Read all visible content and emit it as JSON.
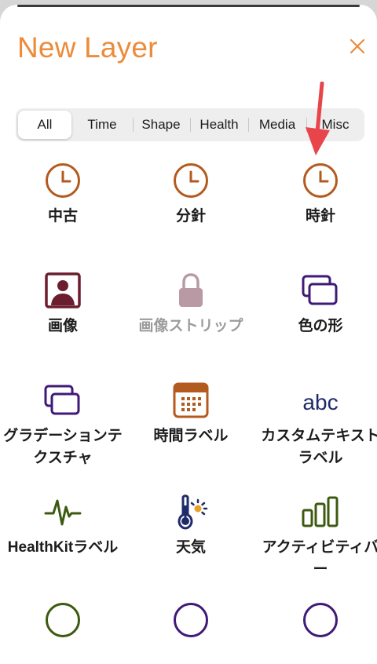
{
  "header": {
    "title": "New Layer",
    "close_icon": "close-icon",
    "accent": "#ec8b3a"
  },
  "tabs": [
    {
      "label": "All",
      "selected": true
    },
    {
      "label": "Time"
    },
    {
      "label": "Shape"
    },
    {
      "label": "Health"
    },
    {
      "label": "Media"
    },
    {
      "label": "Misc"
    }
  ],
  "layers": [
    {
      "label": "中古",
      "icon": "clock-icon",
      "color": "#b35a1f"
    },
    {
      "label": "分針",
      "icon": "clock-icon",
      "color": "#b35a1f"
    },
    {
      "label": "時針",
      "icon": "clock-icon",
      "color": "#b35a1f"
    },
    {
      "label": "画像",
      "icon": "portrait-icon",
      "color": "#6b1f2e"
    },
    {
      "label": "画像ストリップ",
      "icon": "lock-icon",
      "color": "#b99aa4",
      "disabled": true
    },
    {
      "label": "色の形",
      "icon": "cards-icon",
      "color": "#3f1a77"
    },
    {
      "label": "グラデーションテクスチャ",
      "icon": "cards-icon",
      "color": "#3f1a77"
    },
    {
      "label": "時間ラベル",
      "icon": "calendar-icon",
      "color": "#b35a1f"
    },
    {
      "label": "カスタムテキストラベル",
      "icon": "text-abc-icon",
      "text": "abc",
      "color": "#1f2a6b"
    },
    {
      "label": "HealthKitラベル",
      "icon": "heartbeat-icon",
      "color": "#3c5a10"
    },
    {
      "label": "天気",
      "icon": "weather-thermometer-icon",
      "color": "#1f2a6b"
    },
    {
      "label": "アクティビティバー",
      "icon": "activity-bars-icon",
      "color": "#3c5a10"
    },
    {
      "label": "",
      "icon": "circle-icon",
      "color": "#3c5a10"
    },
    {
      "label": "",
      "icon": "circle-icon",
      "color": "#3f1a77"
    },
    {
      "label": "",
      "icon": "circle-icon",
      "color": "#3f1a77"
    }
  ]
}
